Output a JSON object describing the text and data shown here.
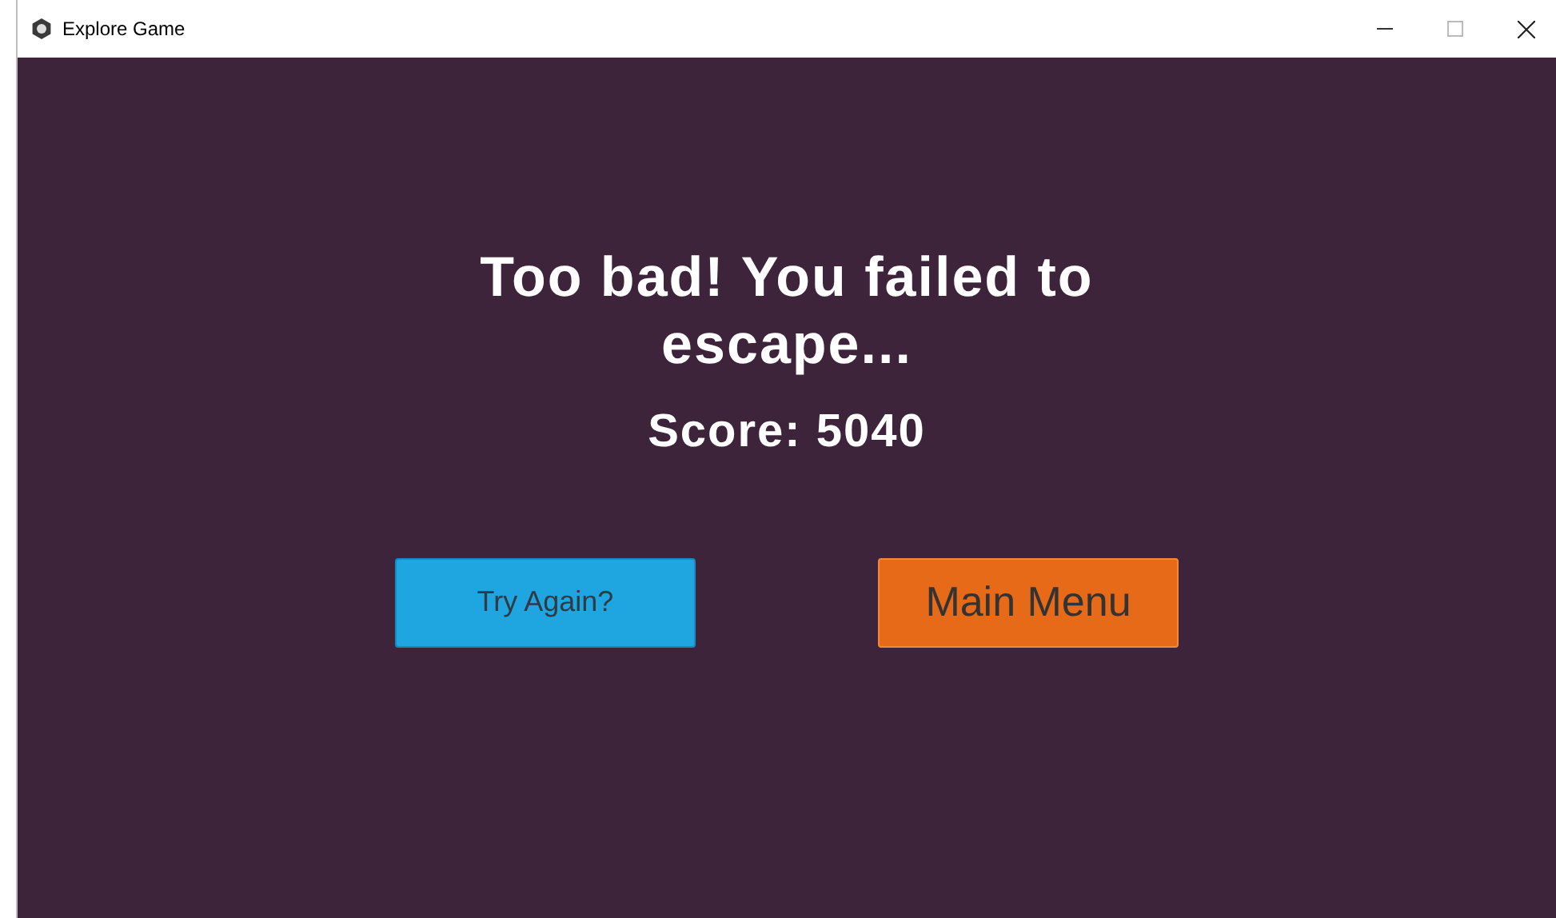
{
  "window": {
    "title": "Explore Game"
  },
  "message": "Too bad! You failed to escape...",
  "score": "Score: 5040",
  "buttons": [
    {
      "label": "Try Again?",
      "kind": "retry"
    },
    {
      "label": "Main Menu",
      "kind": "menu"
    }
  ]
}
